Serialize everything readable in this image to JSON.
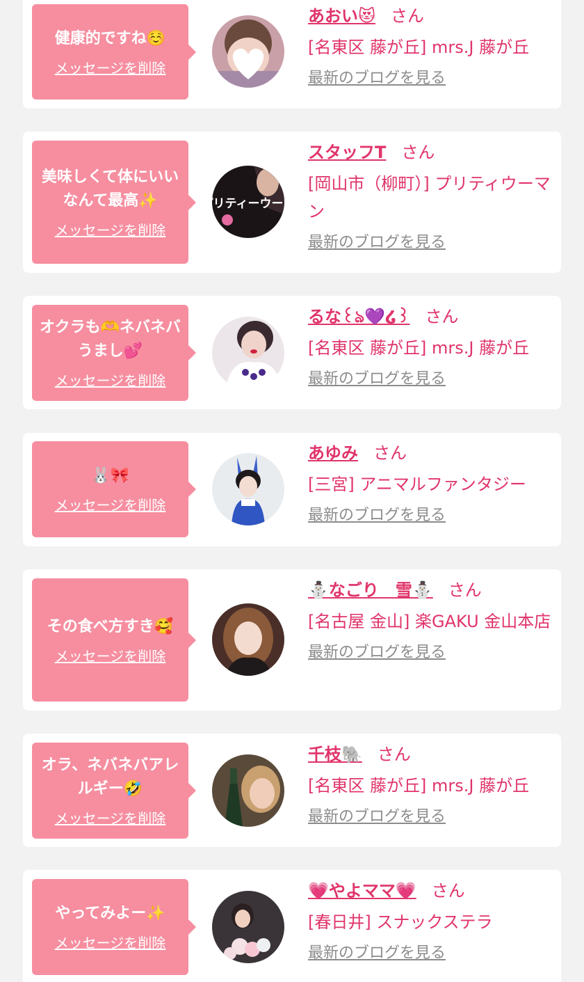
{
  "entries": [
    {
      "message": "健康的ですね☺️",
      "delete_label": "メッセージを削除",
      "name": "あおい😻",
      "honorific": "さん",
      "shop": "[名東区 藤が丘] mrs.J 藤が丘",
      "blog_label": "最新のブログを見る",
      "avatar_icon": "avatar-photo-heart-sticker"
    },
    {
      "message": "美味しくて体にいいなんて最高✨",
      "delete_label": "メッセージを削除",
      "name": "スタッフT",
      "honorific": "さん",
      "shop": "[岡山市（柳町）] プリティウーマン",
      "blog_label": "最新のブログを見る",
      "avatar_icon": "avatar-shop-logo",
      "avatar_text": "プリティーウーマ"
    },
    {
      "message": "オクラも🫶ネバネバうまし💕",
      "delete_label": "メッセージを削除",
      "name": "るな꒰ঌ💜໒꒱",
      "honorific": "さん",
      "shop": "[名東区 藤が丘] mrs.J 藤が丘",
      "blog_label": "最新のブログを見る",
      "avatar_icon": "avatar-photo"
    },
    {
      "message": "🐰🎀",
      "delete_label": "メッセージを削除",
      "name": "あゆみ",
      "honorific": "さん",
      "shop": "[三宮] アニマルファンタジー",
      "blog_label": "最新のブログを見る",
      "avatar_icon": "avatar-photo-bunny"
    },
    {
      "message": "その食べ方すき🥰",
      "delete_label": "メッセージを削除",
      "name": "⛄️なごり　雪⛄️",
      "honorific": "さん",
      "shop": "[名古屋 金山] 楽GAKU 金山本店",
      "blog_label": "最新のブログを見る",
      "avatar_icon": "avatar-photo"
    },
    {
      "message": "オラ、ネバネバアレルギー🤣",
      "delete_label": "メッセージを削除",
      "name": "千枝🐘",
      "honorific": "さん",
      "shop": "[名東区 藤が丘] mrs.J 藤が丘",
      "blog_label": "最新のブログを見る",
      "avatar_icon": "avatar-photo-bottle"
    },
    {
      "message": "やってみよー✨",
      "delete_label": "メッセージを削除",
      "name": "💗やよママ💗",
      "honorific": "さん",
      "shop": "[春日井] スナックステラ",
      "blog_label": "最新のブログを見る",
      "avatar_icon": "avatar-photo-flowers"
    }
  ]
}
